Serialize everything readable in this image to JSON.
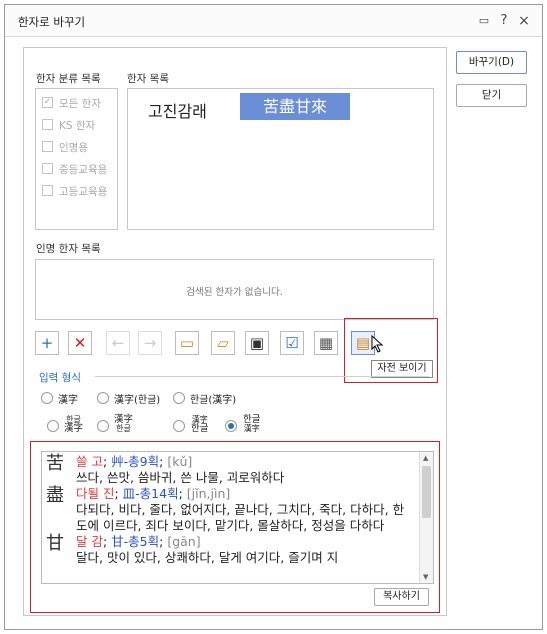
{
  "window": {
    "title": "한자로 바꾸기"
  },
  "titlebar": {
    "help_icon": "?",
    "close_icon": "×"
  },
  "categories": {
    "label": "한자 분류 목록",
    "items": [
      {
        "label": "모든 한자",
        "checked": true
      },
      {
        "label": "KS 한자",
        "checked": false
      },
      {
        "label": "인명용",
        "checked": false
      },
      {
        "label": "중등교육용",
        "checked": false
      },
      {
        "label": "고등교육용",
        "checked": false
      }
    ]
  },
  "hanja_list": {
    "label": "한자 목록",
    "hangul": "고진감래",
    "selected": "苦盡甘來"
  },
  "person_list": {
    "label": "인명 한자 목록",
    "empty_text": "검색된 한자가 없습니다."
  },
  "toolbar": {
    "tooltip": "자전 보이기"
  },
  "input_format": {
    "label": "입력 형식",
    "row1": [
      "漢字",
      "漢字(한글)",
      "한글(漢字)"
    ],
    "row2": [
      {
        "top": "한글",
        "bottom": "漢字"
      },
      {
        "top": "漢字",
        "bottom": "한글"
      },
      {
        "top": "漢字",
        "bottom": "한글"
      },
      {
        "top": "한글",
        "bottom": "漢字"
      }
    ],
    "selected_index": 6
  },
  "dictionary": {
    "entries": [
      {
        "glyph": "苦",
        "reading": "쓸 고",
        "radical": "艸-총9획",
        "pinyin": "[kǔ]",
        "meaning": "쓰다, 쓴맛, 씀바귀, 쓴 나물, 괴로워하다"
      },
      {
        "glyph": "盡",
        "reading": "다될 진",
        "radical": "皿-총14획",
        "pinyin": "[jǐn,jìn]",
        "meaning": "다되다, 비다, 줄다, 없어지다, 끝나다, 그치다, 죽다, 다하다, 한도에 이르다, 죄다 보이다, 맡기다, 몰살하다, 정성을 다하다"
      },
      {
        "glyph": "甘",
        "reading": "달 감",
        "radical": "甘-총5획",
        "pinyin": "[gān]",
        "meaning": "달다, 맛이 있다, 상쾌하다, 달게 여기다, 즐기며 지"
      }
    ],
    "copy_button": "복사하기"
  },
  "buttons": {
    "replace": "바꾸기(D)",
    "close": "닫기"
  }
}
